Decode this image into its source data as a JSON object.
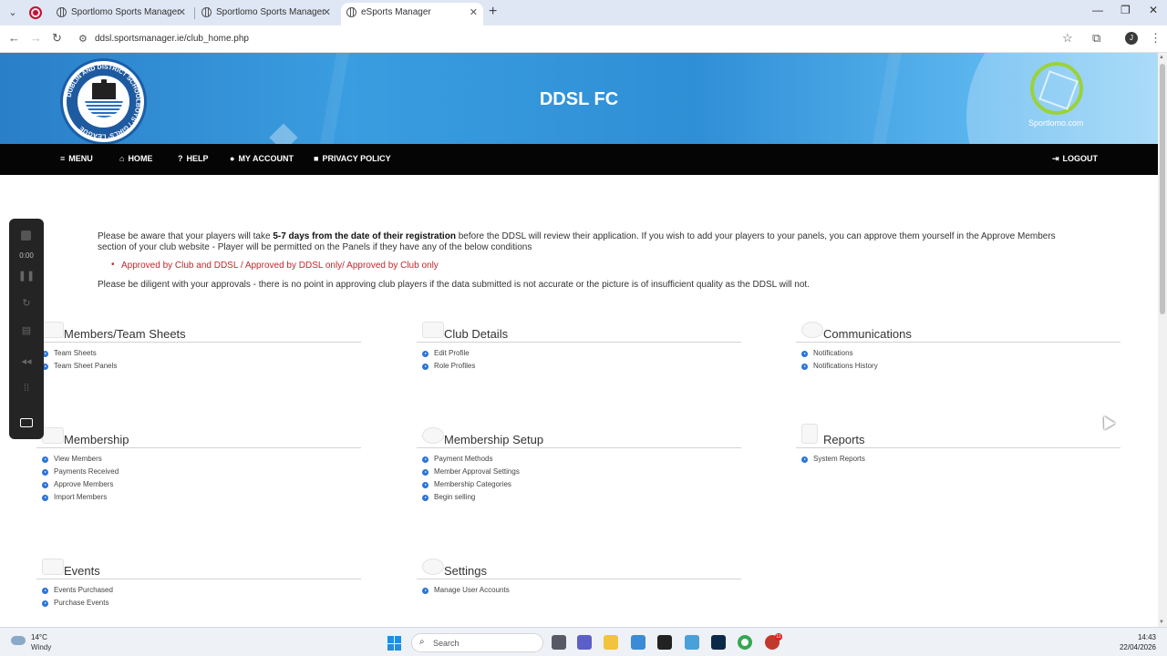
{
  "browser": {
    "tabs": [
      {
        "title": "Sportlomo Sports Manager",
        "active": false
      },
      {
        "title": "Sportlomo Sports Manager",
        "active": false
      },
      {
        "title": "eSports Manager",
        "active": true
      }
    ],
    "url": "ddsl.sportsmanager.ie/club_home.php",
    "profile_initial": "J"
  },
  "header": {
    "site_title": "DDSL FC",
    "logo_text": "DUBLIN AND DISTRICT SCHOOLBOYS' / GIRLS' LEAGUE",
    "brand_text": "Sportlomo.com"
  },
  "nav": {
    "menu": "MENU",
    "home": "HOME",
    "help": "HELP",
    "account": "MY ACCOUNT",
    "privacy": "PRIVACY POLICY",
    "logout": "LOGOUT"
  },
  "notice": {
    "part1": "Please be aware that your players will take ",
    "bold": "5-7 days from the date of their registration",
    "part2": " before the DDSL will review their application. If you wish to add your players to your panels, you can approve them yourself in the Approve Members section of your club website - Player will be permitted on the Panels if they have any of the below conditions",
    "conditions": "Approved by Club and DDSL / Approved by DDSL only/ Approved by Club only",
    "diligence": "Please be diligent with your approvals - there is no point in approving club players if the data submitted is not accurate or the picture is of insufficient quality as the DDSL will not."
  },
  "sections": {
    "members": {
      "title": "Members/Team Sheets",
      "links": [
        "Team Sheets",
        "Team Sheet Panels"
      ]
    },
    "club": {
      "title": "Club Details",
      "links": [
        "Edit Profile",
        "Role Profiles"
      ]
    },
    "comms": {
      "title": "Communications",
      "links": [
        "Notifications",
        "Notifications History"
      ]
    },
    "membership": {
      "title": "Membership",
      "links": [
        "View Members",
        "Payments Received",
        "Approve Members",
        "Import Members"
      ]
    },
    "setup": {
      "title": "Membership Setup",
      "links": [
        "Payment Methods",
        "Member Approval Settings",
        "Membership Categories",
        "Begin selling"
      ]
    },
    "reports": {
      "title": "Reports",
      "links": [
        "System Reports"
      ]
    },
    "events": {
      "title": "Events",
      "links": [
        "Events Purchased",
        "Purchase Events"
      ]
    },
    "settings": {
      "title": "Settings",
      "links": [
        "Manage User Accounts"
      ]
    }
  },
  "recorder": {
    "time": "0:00"
  },
  "taskbar": {
    "temp": "14°C",
    "weather": "Windy",
    "search_placeholder": "Search",
    "badge": "11",
    "time": "14:43",
    "date": "22/04/2026"
  }
}
